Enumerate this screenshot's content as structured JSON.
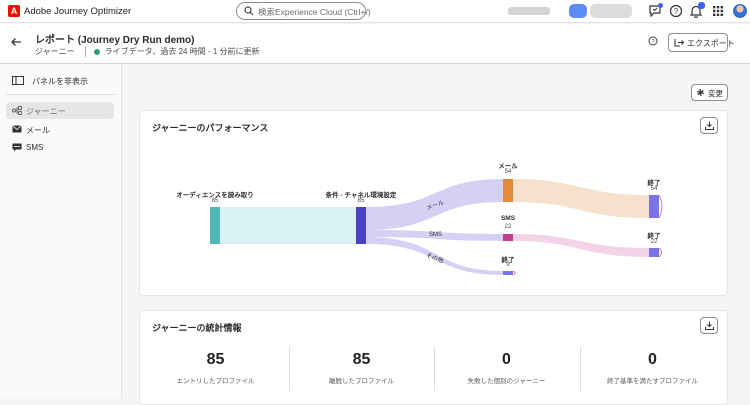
{
  "topbar": {
    "app_name": "Adobe Journey Optimizer",
    "logo_letter": "A",
    "search_placeholder": "検索Experience Cloud (Ctrl+/)"
  },
  "header": {
    "title": "レポート (Journey Dry Run demo)",
    "section": "ジャーニー",
    "status": "ライブデータ、過去 24 時間 - 1 分前に更新",
    "export_label": "エクスポート",
    "status_color": "#2d9d78"
  },
  "sidebar": {
    "toggle_label": "パネルを非表示",
    "items": [
      {
        "label": "ジャーニー",
        "icon": "journey-icon",
        "active": true
      },
      {
        "label": "メール",
        "icon": "mail-icon",
        "active": false
      },
      {
        "label": "SMS",
        "icon": "sms-icon",
        "active": false
      }
    ]
  },
  "toolbar": {
    "change_label": "変更"
  },
  "performance": {
    "title": "ジャーニーのパフォーマンス",
    "nodes": {
      "audience": {
        "label": "オーディエンスを読み取り",
        "value": "85"
      },
      "condition": {
        "label": "条件 - チャネル環境設定",
        "value": "85"
      },
      "mail": {
        "label": "メール",
        "value": "54"
      },
      "sms": {
        "label": "SMS",
        "value": "22"
      },
      "end_small": {
        "label": "終了",
        "value": "9"
      },
      "end_mail": {
        "label": "終了",
        "value": "54"
      },
      "end_sms": {
        "label": "終了",
        "value": "22"
      }
    },
    "links": {
      "mail": "メール",
      "sms": "SMS",
      "other": "その他"
    },
    "colors": {
      "audience": "#4fb8b8",
      "condition": "#4a3fc7",
      "mail": "#e08c3a",
      "sms": "#c43e8e",
      "end": "#7b74e8"
    }
  },
  "stats": {
    "title": "ジャーニーの統計情報",
    "items": [
      {
        "value": "85",
        "label": "エントリしたプロファイル"
      },
      {
        "value": "85",
        "label": "離脱したプロファイル"
      },
      {
        "value": "0",
        "label": "失敗した個別のジャーニー"
      },
      {
        "value": "0",
        "label": "終了基準を満たすプロファイル"
      }
    ]
  }
}
